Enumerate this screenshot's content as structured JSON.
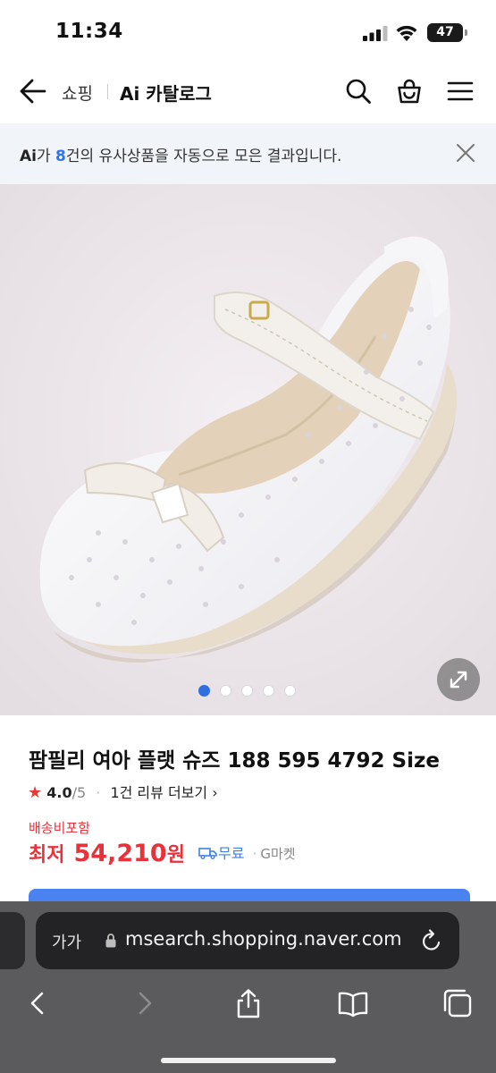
{
  "status_bar": {
    "time": "11:34",
    "battery": "47"
  },
  "header": {
    "crumb_shopping": "쇼핑",
    "crumb_catalog": "Ai 카탈로그",
    "icons": [
      "back-arrow-icon",
      "search-icon",
      "cart-icon",
      "menu-icon"
    ]
  },
  "banner": {
    "ai_label": "Ai",
    "text_before": "가 ",
    "count": "8",
    "text_after": "건의 유사상품을 자동으로 모은 결과입니다."
  },
  "gallery": {
    "total_images": 5,
    "active_index": 0
  },
  "product": {
    "title": "팜필리 여아 플랫 슈즈 188 595 4792 Size",
    "rating_star": "★",
    "rating_score": "4.0",
    "rating_max": "/5",
    "bullet": "·",
    "review_link": "1건 리뷰 더보기",
    "review_chevron": "›",
    "shipping_included": "배송비포함",
    "price_label": "최저",
    "price_value": "54,210",
    "price_unit": "원",
    "delivery": "무료",
    "seller": "G마켓"
  },
  "browser": {
    "text_size_label": "가가",
    "url": "msearch.shopping.naver.com"
  },
  "colors": {
    "accent_red": "#e7323a",
    "accent_blue": "#2f74f0",
    "banner_bg": "#f1f4f9",
    "cta_blue": "#4b82f1"
  }
}
